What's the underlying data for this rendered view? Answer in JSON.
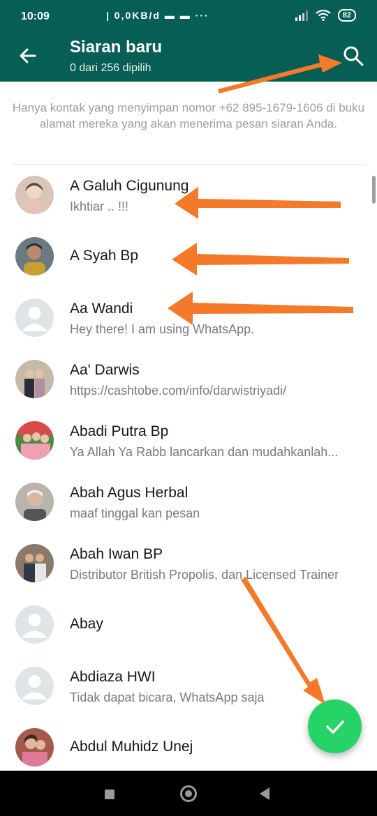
{
  "status_bar": {
    "time": "10:09",
    "speed": "| 0,0KB/d",
    "icons": "▬ ▬ ···",
    "battery": "82"
  },
  "appbar": {
    "title": "Siaran baru",
    "subtitle": "0 dari 256 dipilih",
    "back_icon": "arrow-left",
    "search_icon": "magnifier"
  },
  "notice": "Hanya kontak yang menyimpan nomor +62 895-1679-1606 di buku alamat mereka yang akan menerima pesan siaran Anda.",
  "contacts": [
    {
      "name": "A Galuh Cigunung",
      "status": "Ikhtiar .. !!!",
      "avatar_color": "#d9c6b8"
    },
    {
      "name": "A Syah Bp",
      "status": "",
      "avatar_color": "#6b7a80"
    },
    {
      "name": "Aa Wandi",
      "status": "Hey there! I am using WhatsApp.",
      "avatar_color": "#dfe5e7"
    },
    {
      "name": "Aa' Darwis",
      "status": "https://cashtobe.com/info/darwistriyadi/",
      "avatar_color": "#c7b9a8"
    },
    {
      "name": "Abadi Putra Bp",
      "status": "Ya Allah Ya Rabb  lancarkan dan mudahkanlah...",
      "avatar_color": "#4d8a4a"
    },
    {
      "name": "Abah Agus Herbal",
      "status": "maaf tinggal kan pesan",
      "avatar_color": "#b8b4ad"
    },
    {
      "name": "Abah Iwan BP",
      "status": "Distributor British Propolis, dan Licensed Trainer",
      "avatar_color": "#8a7a6a"
    },
    {
      "name": "Abay",
      "status": "",
      "avatar_color": "#dfe5e7"
    },
    {
      "name": "Abdiaza HWI",
      "status": "Tidak dapat bicara, WhatsApp saja",
      "avatar_color": "#dfe5e7"
    },
    {
      "name": "Abdul Muhidz Unej",
      "status": "",
      "avatar_color": "#a35a4a"
    }
  ],
  "fab": {
    "icon": "check"
  },
  "colors": {
    "primary": "#075e54",
    "fab": "#25d366",
    "annotation": "#f47a2a"
  }
}
